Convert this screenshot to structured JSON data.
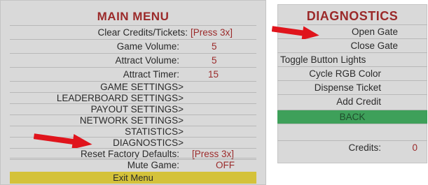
{
  "main_menu": {
    "title": "MAIN MENU",
    "items": [
      {
        "label": "Clear Credits/Tickets:",
        "value": "[Press 3x]"
      },
      {
        "label": "Game Volume:",
        "value": "5"
      },
      {
        "label": "Attract Volume:",
        "value": "5"
      },
      {
        "label": "Attract Timer:",
        "value": "15"
      },
      {
        "label": "GAME SETTINGS>"
      },
      {
        "label": "LEADERBOARD SETTINGS>"
      },
      {
        "label": "PAYOUT SETTINGS>"
      },
      {
        "label": "NETWORK SETTINGS>"
      },
      {
        "label": "STATISTICS>"
      },
      {
        "label": "DIAGNOSTICS>"
      },
      {
        "label": "Reset Factory Defaults:",
        "value": "[Press 3x]"
      },
      {
        "label": "Mute Game:",
        "value": "OFF"
      },
      {
        "label": "Exit Menu"
      }
    ]
  },
  "diagnostics": {
    "title": "DIAGNOSTICS",
    "items": [
      {
        "label": "Open Gate"
      },
      {
        "label": "Close Gate"
      },
      {
        "label": "Toggle Button Lights"
      },
      {
        "label": "Cycle RGB Color"
      },
      {
        "label": "Dispense Ticket"
      },
      {
        "label": "Add Credit"
      },
      {
        "label": "BACK"
      },
      {
        "label": ""
      },
      {
        "label": "Credits:",
        "value": "0"
      }
    ]
  },
  "colors": {
    "panel": "#d9d9d9",
    "title": "#9b2a2a",
    "highlight_exit": "#d4c23a",
    "highlight_back": "#3ea05a",
    "arrow": "#e0141c"
  },
  "icons": [
    "arrow-right-icon",
    "arrow-right-icon"
  ]
}
